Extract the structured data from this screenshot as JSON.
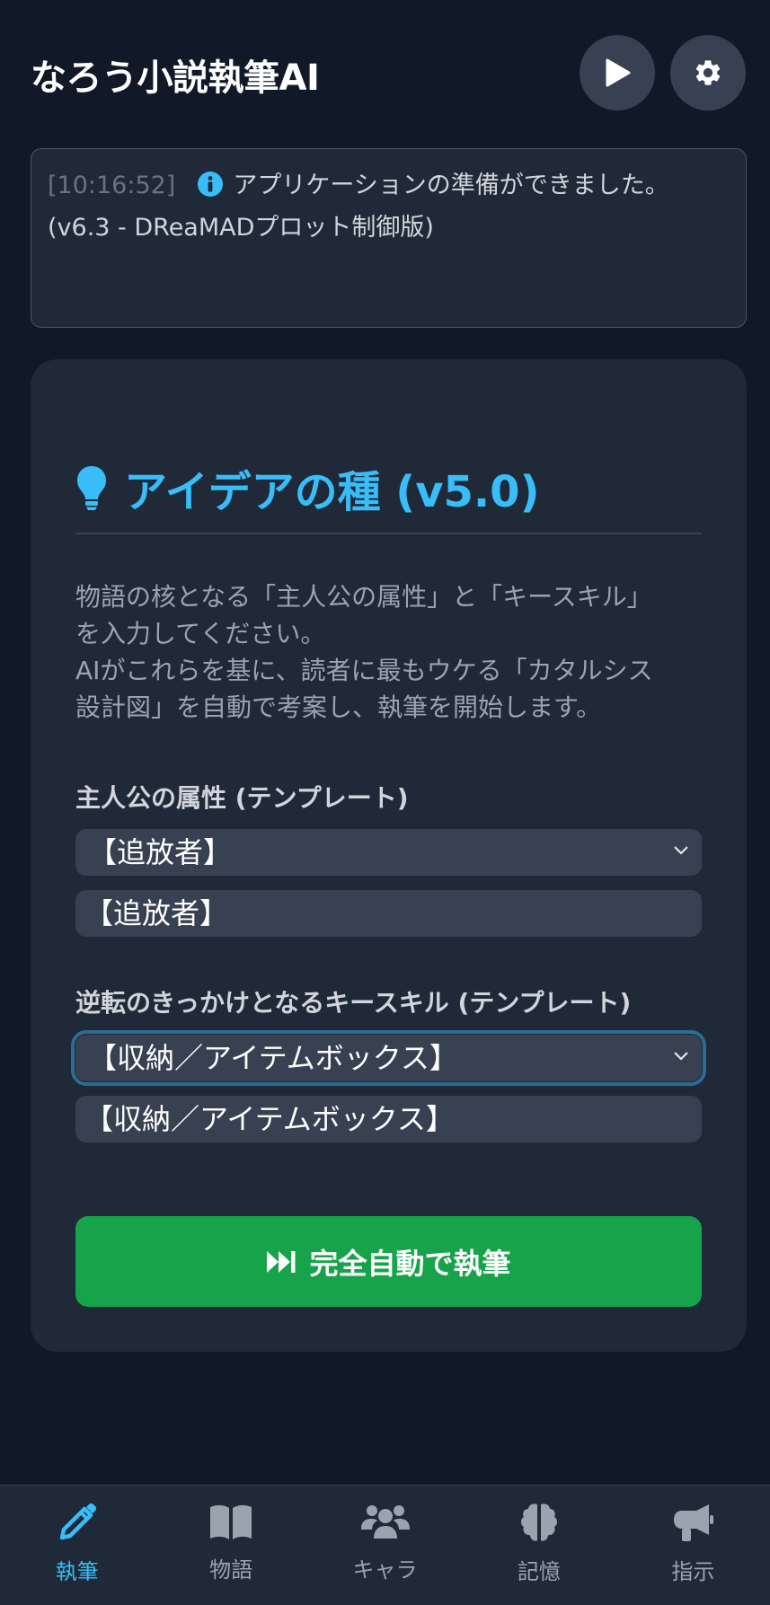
{
  "header": {
    "title": "なろう小説執筆AI",
    "play_icon": "play-icon",
    "settings_icon": "gear-icon"
  },
  "log": {
    "time": "[10:16:52]",
    "icon": "info-icon",
    "message": "アプリケーションの準備ができました。(v6.3 - DReaMADプロット制御版)"
  },
  "card": {
    "icon": "lightbulb-icon",
    "title": "アイデアの種 (v5.0)",
    "description_lines": [
      "物語の核となる「主人公の属性」と「キースキル」",
      "を入力してください。",
      "AIがこれらを基に、読者に最もウケる「カタルシス",
      "設計図」を自動で考案し、執筆を開始します。"
    ],
    "protagonist": {
      "label": "主人公の属性 (テンプレート)",
      "selected": "【追放者】",
      "input_value": "【追放者】"
    },
    "skill": {
      "label": "逆転のきっかけとなるキースキル (テンプレート)",
      "selected": "【収納／アイテムボックス】",
      "input_value": "【収納／アイテムボックス】"
    },
    "button": {
      "icon": "fast-forward-icon",
      "label": "完全自動で執筆"
    }
  },
  "nav": {
    "items": [
      {
        "label": "執筆",
        "icon": "pencil-icon",
        "active": true
      },
      {
        "label": "物語",
        "icon": "book-icon",
        "active": false
      },
      {
        "label": "キャラ",
        "icon": "users-icon",
        "active": false
      },
      {
        "label": "記憶",
        "icon": "brain-icon",
        "active": false
      },
      {
        "label": "指示",
        "icon": "megaphone-icon",
        "active": false
      }
    ]
  },
  "colors": {
    "accent": "#38bdf8",
    "primary_button": "#16a34a",
    "background": "#111827",
    "card": "#1f2937"
  }
}
